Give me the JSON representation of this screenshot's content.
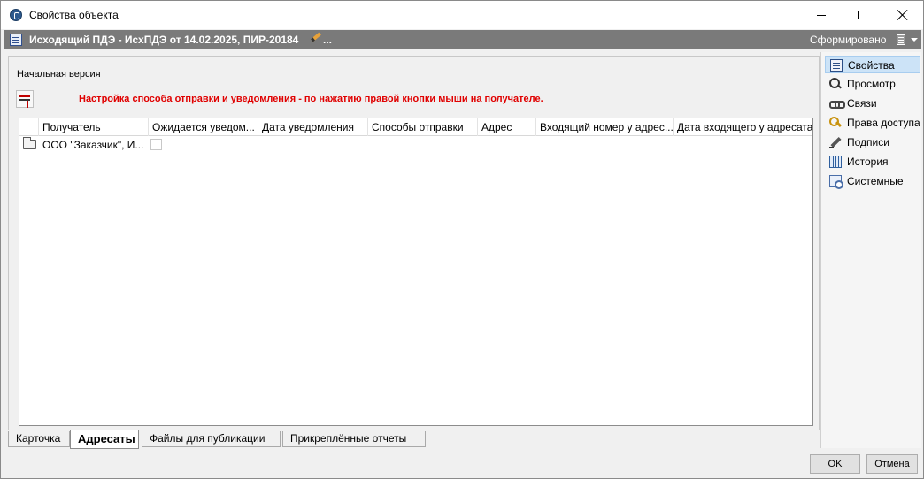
{
  "window": {
    "title": "Свойства объекта"
  },
  "object_bar": {
    "title": "Исходящий ПДЭ - ИсхПДЭ от 14.02.2025, ПИР-20184",
    "ellipsis": "...",
    "status": "Сформировано"
  },
  "content": {
    "version_label": "Начальная версия",
    "hint": "Настройка способа отправки и уведомления - по нажатию правой кнопки мыши на получателе."
  },
  "grid": {
    "columns": [
      "Получатель",
      "Ожидается уведом...",
      "Дата уведомления",
      "Способы отправки",
      "Адрес",
      "Входящий номер у адрес...",
      "Дата входящего у адресата"
    ],
    "rows": [
      {
        "recipient": "ООО \"Заказчик\", И...",
        "notification_expected": false
      }
    ]
  },
  "tabs": [
    {
      "label": "Карточка",
      "active": false
    },
    {
      "label": "Адресаты",
      "active": true
    },
    {
      "label": "Файлы для публикации",
      "active": false
    },
    {
      "label": "Прикреплённые отчеты",
      "active": false
    }
  ],
  "sidebar": {
    "items": [
      {
        "label": "Свойства",
        "icon": "properties-icon",
        "active": true
      },
      {
        "label": "Просмотр",
        "icon": "magnifier-icon",
        "active": false
      },
      {
        "label": "Связи",
        "icon": "chain-link-icon",
        "active": false
      },
      {
        "label": "Права доступа",
        "icon": "keys-icon",
        "active": false
      },
      {
        "label": "Подписи",
        "icon": "pen-icon",
        "active": false
      },
      {
        "label": "История",
        "icon": "history-books-icon",
        "active": false
      },
      {
        "label": "Системные",
        "icon": "system-settings-icon",
        "active": false
      }
    ]
  },
  "buttons": {
    "ok": "OK",
    "cancel": "Отмена"
  },
  "colors": {
    "hint": "#e00000",
    "object_bar": "#7a7a7a",
    "sidebar_active": "#cce3f7"
  }
}
